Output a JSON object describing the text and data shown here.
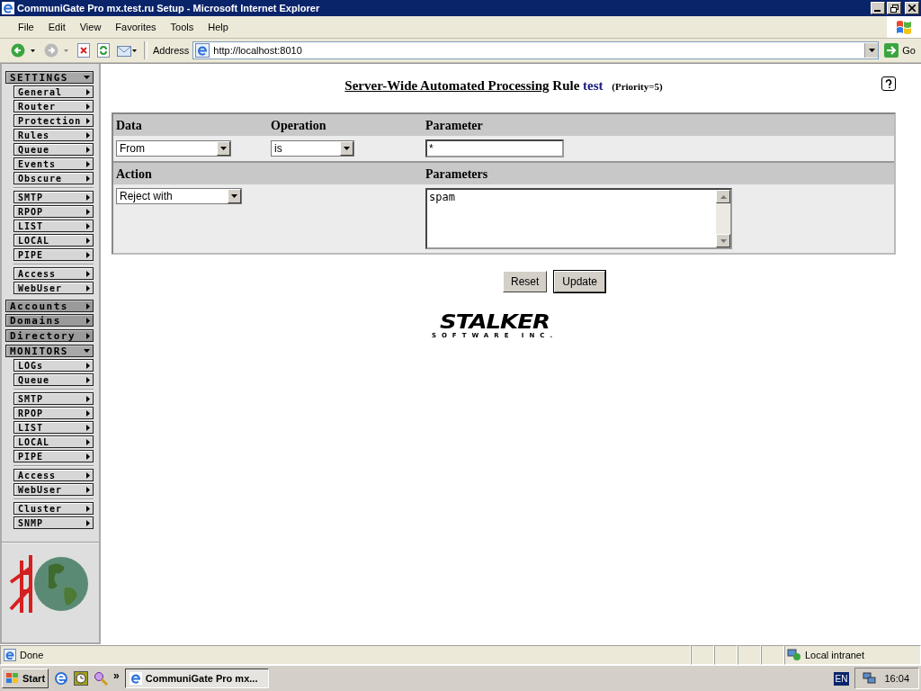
{
  "window": {
    "title": "CommuniGate Pro mx.test.ru Setup - Microsoft Internet Explorer"
  },
  "menu": [
    "File",
    "Edit",
    "View",
    "Favorites",
    "Tools",
    "Help"
  ],
  "address": {
    "label": "Address",
    "value": "http://localhost:8010",
    "go": "Go"
  },
  "sidebar": [
    [
      {
        "label": "SETTINGS",
        "expanded": true,
        "groups": [
          [
            "General",
            "Router",
            "Protection",
            "Rules",
            "Queue",
            "Events",
            "Obscure"
          ],
          [
            "SMTP",
            "RPOP",
            "LIST",
            "LOCAL",
            "PIPE"
          ],
          [
            "Access",
            "WebUser"
          ]
        ]
      }
    ],
    [
      {
        "label": "Accounts",
        "expanded": false
      },
      {
        "label": "Domains",
        "expanded": false
      }
    ],
    [
      {
        "label": "Directory",
        "expanded": false
      }
    ],
    [
      {
        "label": "MONITORS",
        "expanded": true,
        "groups": [
          [
            "LOGs",
            "Queue"
          ],
          [
            "SMTP",
            "RPOP",
            "LIST",
            "LOCAL",
            "PIPE"
          ],
          [
            "Access",
            "WebUser"
          ],
          [
            "Cluster",
            "SNMP"
          ]
        ]
      }
    ]
  ],
  "heading": {
    "title": "Server-Wide Automated Processing",
    "word": "Rule",
    "name": "test",
    "priority": "(Priority=5)"
  },
  "form": {
    "columns": [
      "Data",
      "Operation",
      "Parameter"
    ],
    "data": "From",
    "operation": "is",
    "parameter": "*",
    "columns_2": [
      "Action",
      "Parameters"
    ],
    "action": "Reject with",
    "parameters": "spam"
  },
  "buttons": [
    "Reset",
    "Update"
  ],
  "logo": {
    "name": "STALKER",
    "sub": "SOFTWARE INC."
  },
  "status_bar": {
    "text": "Done",
    "zone": "Local intranet"
  },
  "taskbar": {
    "start": "Start",
    "more": "»",
    "task": "CommuniGate Pro mx...",
    "lang": "EN",
    "time": "16:04"
  }
}
